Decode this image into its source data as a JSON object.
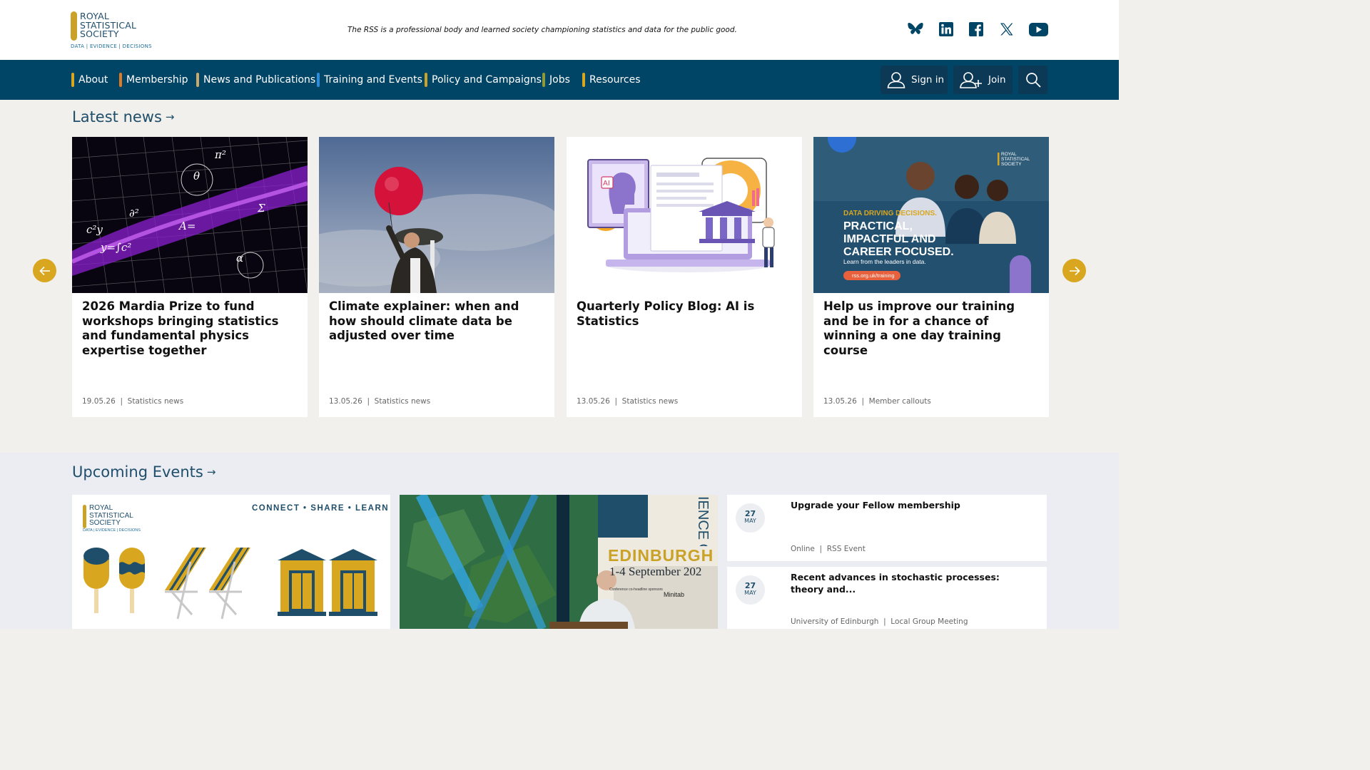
{
  "header": {
    "logo": {
      "name_lines": [
        "ROYAL",
        "STATISTICAL",
        "SOCIETY"
      ],
      "tagline": "DATA | EVIDENCE | DECISIONS"
    },
    "mission": "The RSS is a professional body and learned society championing statistics and data for the public good.",
    "social": [
      {
        "icon": "bluesky-icon"
      },
      {
        "icon": "linkedin-icon"
      },
      {
        "icon": "facebook-icon"
      },
      {
        "icon": "x-icon"
      },
      {
        "icon": "youtube-icon"
      }
    ]
  },
  "nav": {
    "items": [
      {
        "label": "About",
        "accent": "#d8a71f"
      },
      {
        "label": "Membership",
        "accent": "#e07b24"
      },
      {
        "label": "News and Publications",
        "accent": "#c9a86a"
      },
      {
        "label": "Training and Events",
        "accent": "#2e8bd8"
      },
      {
        "label": "Policy and Campaigns",
        "accent": "#c9a227"
      },
      {
        "label": "Jobs",
        "accent": "#8e9a3a"
      },
      {
        "label": "Resources",
        "accent": "#d8a71f"
      }
    ],
    "sign_in": "Sign in",
    "join": "Join"
  },
  "latest_news": {
    "title": "Latest news",
    "cards": [
      {
        "title": "2026 Mardia Prize to fund workshops bringing statistics and fundamental physics expertise together",
        "date": "19.05.26",
        "category": "Statistics news"
      },
      {
        "title": "Climate explainer: when and how should climate data be adjusted over time",
        "date": "13.05.26",
        "category": "Statistics news"
      },
      {
        "title": "Quarterly Policy Blog: AI is Statistics",
        "date": "13.05.26",
        "category": "Statistics news",
        "image_badge": "AI"
      },
      {
        "title": "Help us improve our training and be in for a chance of winning a one day training course",
        "date": "13.05.26",
        "category": "Member callouts",
        "image_text": {
          "kicker": "DATA DRIVING DECISIONS.",
          "headline": [
            "PRACTICAL,",
            "IMPACTFUL AND",
            "CAREER FOCUSED."
          ],
          "sub": "Learn from the leaders in data.",
          "url": "rss.org.uk/training",
          "logo_lines": [
            "ROYAL",
            "STATISTICAL",
            "SOCIETY"
          ]
        }
      }
    ]
  },
  "events": {
    "title": "Upcoming Events",
    "promo": {
      "logo_lines": [
        "ROYAL",
        "STATISTICAL",
        "SOCIETY"
      ],
      "logo_tagline": "DATA | EVIDENCE | DECISIONS",
      "slogan": "CONNECT • SHARE • LEARN"
    },
    "conference": {
      "banner_city": "EDINBURGH",
      "banner_dates": "1-4 September 202",
      "banner_vertical": "IENCE CASE",
      "sponsor_label": "Conference co-headline sponsors",
      "sponsor": "Minitab"
    },
    "list": [
      {
        "day": "27",
        "month": "MAY",
        "title": "Upgrade your Fellow membership",
        "location": "Online",
        "type": "RSS Event"
      },
      {
        "day": "27",
        "month": "MAY",
        "title": "Recent advances in stochastic processes: theory and...",
        "location": "University of Edinburgh",
        "type": "Local Group Meeting"
      }
    ]
  },
  "colors": {
    "nav_bg": "#004466",
    "brand_blue": "#1f4e6b",
    "gold": "#d8a71f"
  }
}
